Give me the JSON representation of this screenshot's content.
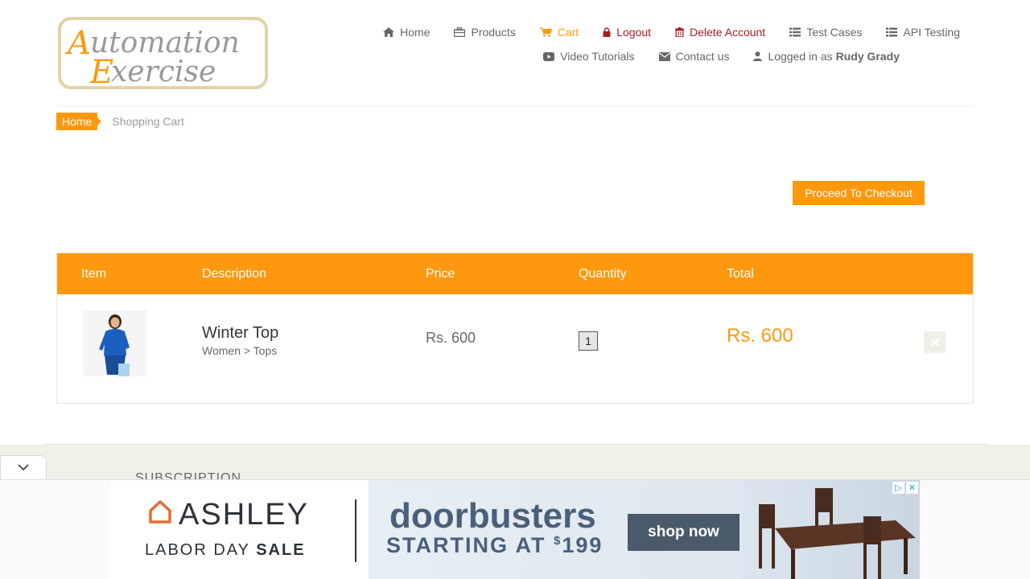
{
  "logo": {
    "line1": "Automation",
    "line2": "Exercise"
  },
  "nav": {
    "row1": [
      {
        "label": "Home",
        "icon": "home-icon"
      },
      {
        "label": "Products",
        "icon": "briefcase-icon"
      },
      {
        "label": "Cart",
        "icon": "cart-icon"
      },
      {
        "label": "Logout",
        "icon": "lock-icon"
      },
      {
        "label": "Delete Account",
        "icon": "trash-icon"
      },
      {
        "label": "Test Cases",
        "icon": "list-icon"
      },
      {
        "label": "API Testing",
        "icon": "list-icon"
      }
    ],
    "row2": [
      {
        "label": "Video Tutorials",
        "icon": "youtube-icon"
      },
      {
        "label": "Contact us",
        "icon": "envelope-icon"
      }
    ],
    "logged_in_prefix": "Logged in as",
    "username": "Rudy Grady"
  },
  "breadcrumb": {
    "home": "Home",
    "current": "Shopping Cart"
  },
  "checkout_button": "Proceed To Checkout",
  "table": {
    "headers": [
      "Item",
      "Description",
      "Price",
      "Quantity",
      "Total"
    ],
    "rows": [
      {
        "name": "Winter Top",
        "category": "Women > Tops",
        "price": "Rs. 600",
        "quantity": "1",
        "total": "Rs. 600"
      }
    ]
  },
  "footer": {
    "subscription": "SUBSCRIPTION"
  },
  "ad": {
    "brand": "ASHLEY",
    "sale_prefix": "LABOR DAY",
    "sale_bold": "SALE",
    "headline": "doorbusters",
    "starting": "STARTING AT",
    "price_sup": "$",
    "price": "199",
    "cta": "shop now"
  },
  "colors": {
    "accent": "#FE980F",
    "danger": "#A31D25",
    "text": "#696763"
  }
}
